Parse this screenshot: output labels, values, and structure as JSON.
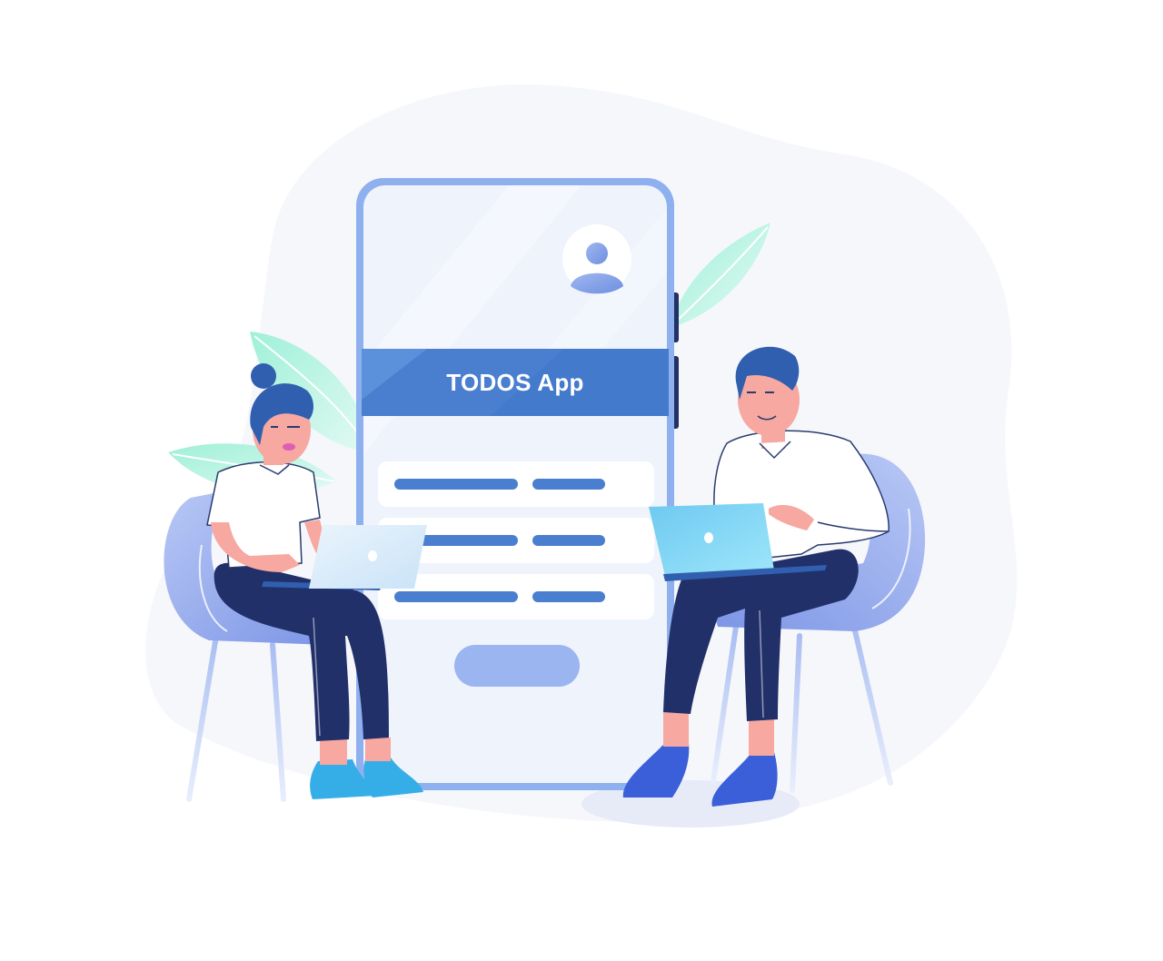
{
  "app": {
    "banner_title": "TODOS App"
  },
  "colors": {
    "accent": "#4a7fd0",
    "banner": "#4a7fd0",
    "banner_light": "#5b90da",
    "phone_frame": "#8fb0ee",
    "phone_screen": "#f0f5fd",
    "chair": "#8fa8ee",
    "pants": "#22306a",
    "hair": "#2f5fae",
    "shoes_left": "#35aee8",
    "shoes_right": "#3a5fd8",
    "laptop_left": "#d6ebfa",
    "laptop_right": "#7dd8f6",
    "leaf": "#bff2e5",
    "skin": "#f6a8a1"
  },
  "phone": {
    "list_items": [
      {
        "bars": 2
      },
      {
        "bars": 2
      },
      {
        "bars": 2
      }
    ],
    "button_label": ""
  },
  "icons": [
    "user-avatar-icon",
    "laptop-logo-icon"
  ]
}
